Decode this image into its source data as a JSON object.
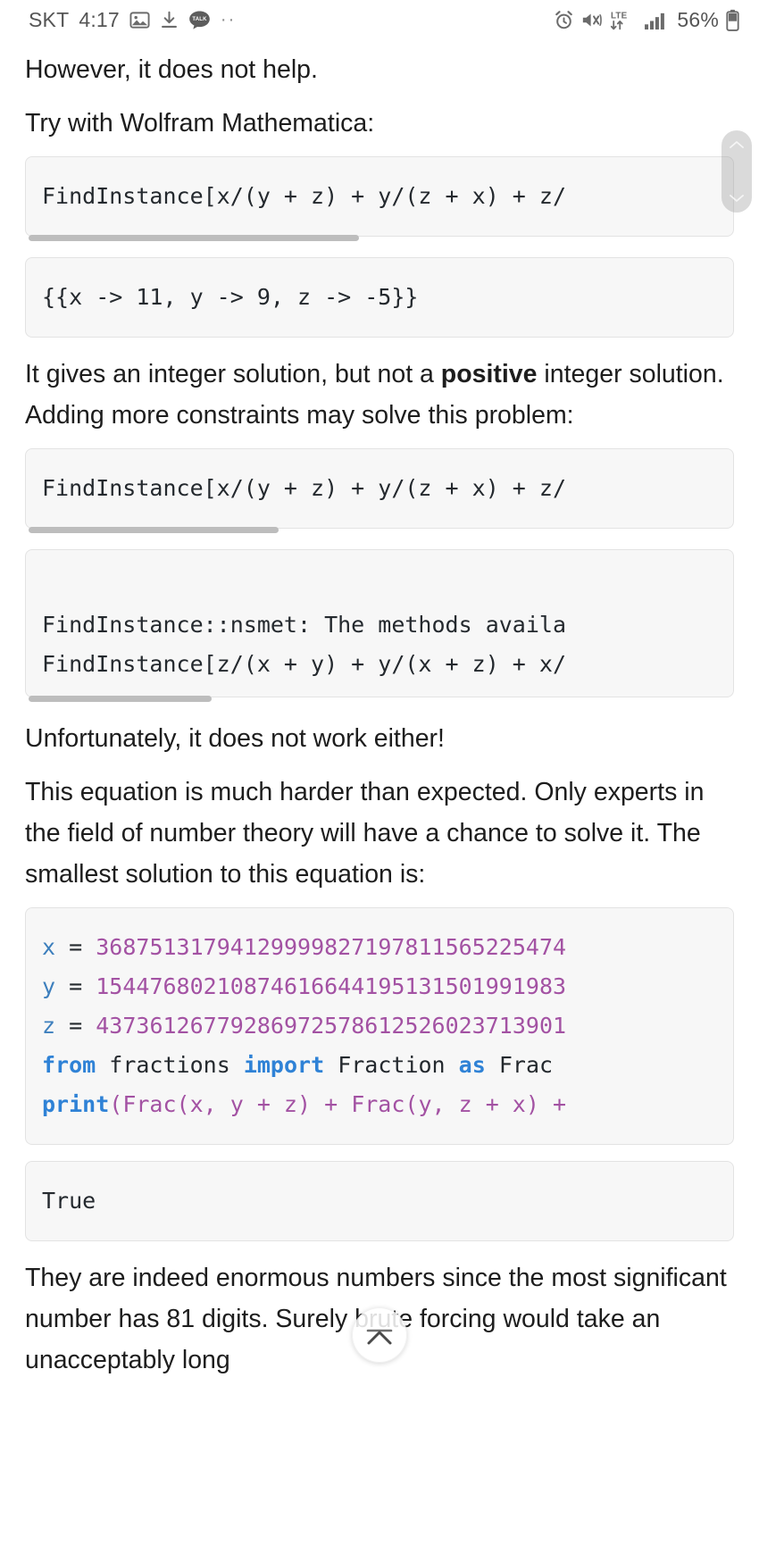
{
  "statusbar": {
    "carrier": "SKT",
    "time": "4:17",
    "icons_left": [
      "image-icon",
      "download-icon",
      "kakaotalk-icon",
      "more-dots-icon"
    ],
    "more_dots": "··",
    "icons_right": [
      "alarm-icon",
      "mute-icon",
      "lte-icon",
      "signal-bars-icon",
      "battery-icon"
    ],
    "lte_label": "LTE",
    "battery_percent": "56%"
  },
  "article": {
    "p1": "However, it does not help.",
    "p2": "Try with Wolfram Mathematica:",
    "code1": "FindInstance[x/(y + z) + y/(z + x) + z/",
    "code2": "{{x -> 11, y -> 9, z -> -5}}",
    "p3_a": "It gives an integer solution, but not a ",
    "p3_b": "positive",
    "p3_c": " integer solution. Adding more constraints may solve this problem:",
    "code3": "FindInstance[x/(y + z) + y/(z + x) + z/",
    "code4_line1": "FindInstance::nsmet: The methods availa",
    "code4_line2": "FindInstance[z/(x + y) + y/(x + z) + x/",
    "p4": "Unfortunately, it does not work either!",
    "p5": "This equation is much harder than expected. Only experts in the field of number theory will have a chance to solve it. The smallest solution to this equation is:",
    "code5": {
      "x_name": "x",
      "y_name": "y",
      "z_name": "z",
      "eq": "=",
      "x_value": "36875131794129999827197811565225474",
      "y_value": "15447680210874616644195131501991983",
      "z_value": "43736126779286972578612526023713901",
      "kw_from": "from",
      "mod_fractions": "fractions",
      "kw_import": "import",
      "cls_Fraction": "Fraction",
      "kw_as": "as",
      "alias_Frac": "Frac",
      "fn_print": "print",
      "print_args": "(Frac(x, y + z) + Frac(y, z + x) +"
    },
    "code6": "True",
    "p6": "They are indeed enormous numbers since the most significant number has 81 digits. Surely brute forcing would take an unacceptably long"
  },
  "controls": {
    "scroll_pill": "scroll-position-indicator",
    "to_top": "scroll-to-top-button"
  },
  "colors": {
    "code_bg": "#f7f7f7",
    "code_border": "#e3e3e3",
    "keyword": "#2f82d6",
    "number": "#a352a3",
    "variable": "#3d7fbd",
    "text": "#1d1d1d",
    "statusbar_text": "#555555",
    "scrollbar": "#bdbdbd"
  }
}
